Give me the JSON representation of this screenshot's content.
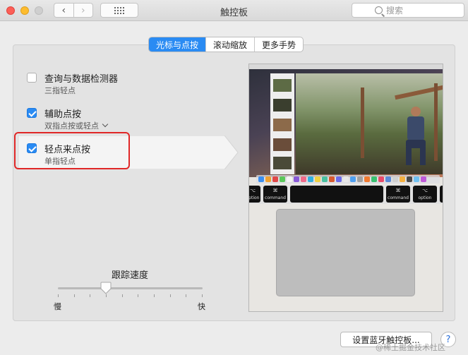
{
  "window": {
    "title": "触控板"
  },
  "toolbar": {
    "back_glyph": "‹",
    "forward_glyph": "›",
    "search_placeholder": "搜索"
  },
  "tabs": [
    {
      "label": "光标与点按",
      "active": true
    },
    {
      "label": "滚动缩放",
      "active": false
    },
    {
      "label": "更多手势",
      "active": false
    }
  ],
  "options": [
    {
      "title": "查询与数据检测器",
      "subtitle": "三指轻点",
      "checked": false
    },
    {
      "title": "辅助点按",
      "subtitle": "双指点按或轻点",
      "checked": true,
      "has_dropdown": true
    },
    {
      "title": "轻点来点按",
      "subtitle": "单指轻点",
      "checked": true,
      "selected": true
    }
  ],
  "tracking_speed": {
    "label": "跟踪速度",
    "min_label": "慢",
    "max_label": "快",
    "value_fraction": 0.33
  },
  "preview": {
    "left_key_top": "⌥",
    "left_key_bottom": "option",
    "cmd_glyph": "⌘",
    "cmd_label": "command",
    "right_option_top": "⌥",
    "right_option_bottom": "option",
    "right_key_top": "◀"
  },
  "bottom": {
    "bluetooth_button": "设置蓝牙触控板...",
    "help_label": "?"
  },
  "watermark": "@稀土掘金技术社区",
  "colors": {
    "accent": "#2a8bf3",
    "highlight": "#e02727"
  }
}
